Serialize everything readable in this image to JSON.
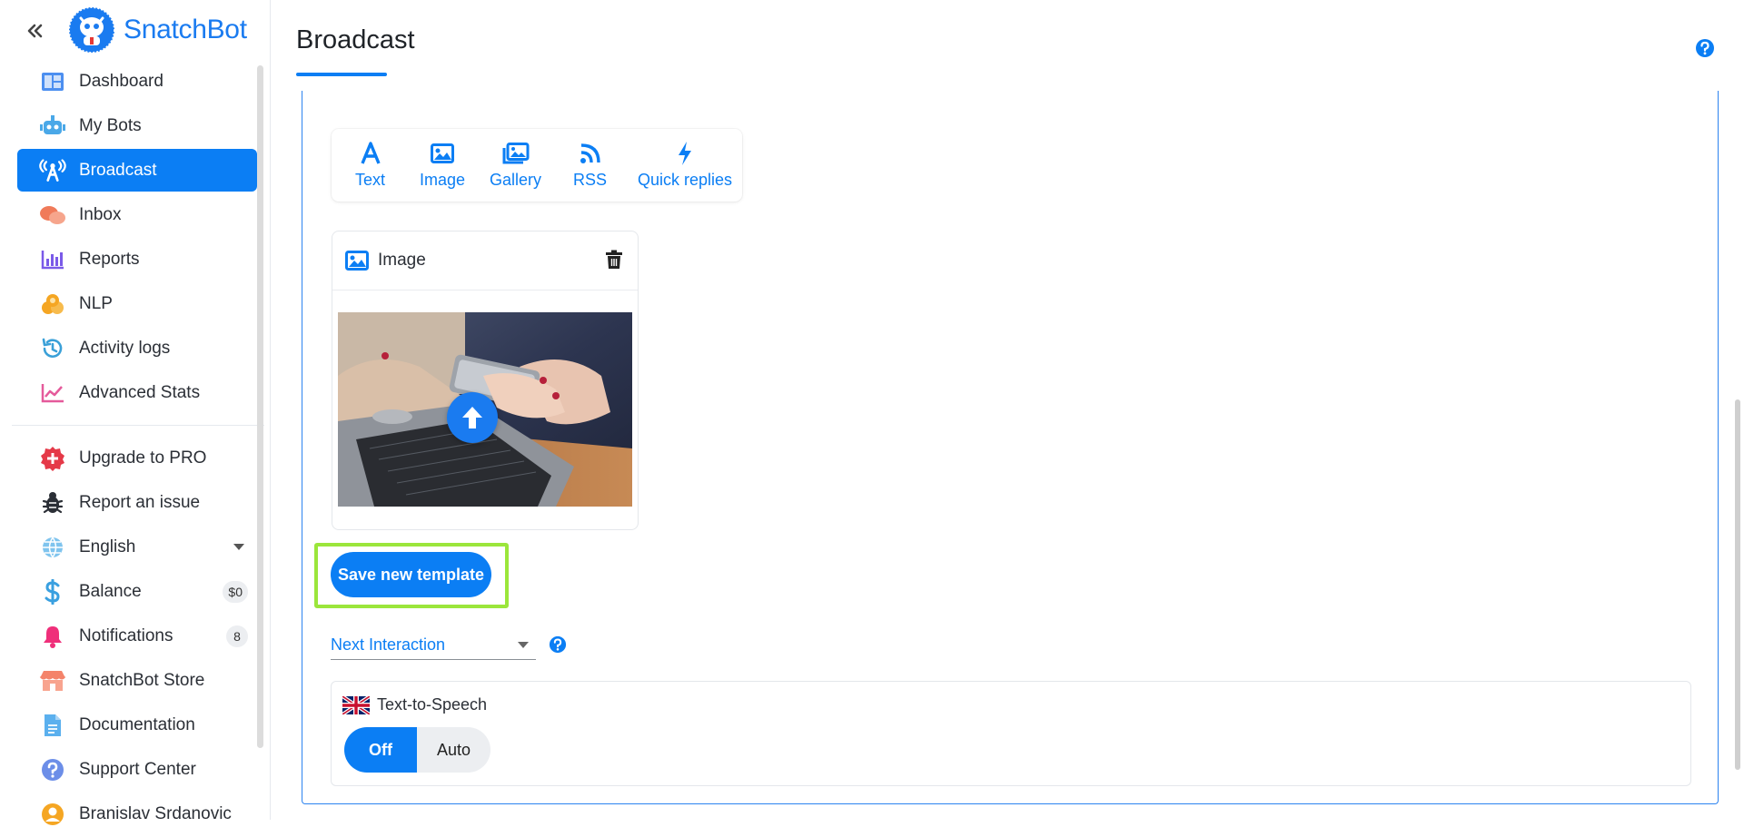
{
  "brand": {
    "name": "SnatchBot",
    "color": "#1a7bf0"
  },
  "sidebar": {
    "collapse_icon": "double-chevron-left-icon",
    "items": [
      {
        "label": "Dashboard",
        "icon": "dashboard-icon"
      },
      {
        "label": "My Bots",
        "icon": "bot-icon"
      },
      {
        "label": "Broadcast",
        "icon": "broadcast-icon",
        "active": true
      },
      {
        "label": "Inbox",
        "icon": "chat-bubbles-icon"
      },
      {
        "label": "Reports",
        "icon": "bar-chart-icon"
      },
      {
        "label": "NLP",
        "icon": "coins-icon"
      },
      {
        "label": "Activity logs",
        "icon": "history-icon"
      },
      {
        "label": "Advanced Stats",
        "icon": "line-chart-icon"
      }
    ],
    "secondary": [
      {
        "label": "Upgrade to PRO",
        "icon": "plus-badge-icon"
      },
      {
        "label": "Report an issue",
        "icon": "bug-icon"
      },
      {
        "label": "English",
        "icon": "globe-icon"
      },
      {
        "label": "Balance",
        "icon": "dollar-icon",
        "badge": "$0"
      },
      {
        "label": "Notifications",
        "icon": "bell-icon",
        "badge": "8"
      },
      {
        "label": "SnatchBot Store",
        "icon": "store-icon"
      },
      {
        "label": "Documentation",
        "icon": "document-icon"
      },
      {
        "label": "Support Center",
        "icon": "question-circle-icon"
      },
      {
        "label": "Branislav Srdanovic",
        "icon": "user-avatar-icon"
      }
    ]
  },
  "page": {
    "title": "Broadcast",
    "accent": "#0b7ef4"
  },
  "toolbar": {
    "tools": [
      {
        "label": "Text",
        "icon": "text-a-icon"
      },
      {
        "label": "Image",
        "icon": "image-icon"
      },
      {
        "label": "Gallery",
        "icon": "gallery-icon"
      },
      {
        "label": "RSS",
        "icon": "rss-icon"
      },
      {
        "label": "Quick replies",
        "icon": "lightning-icon"
      }
    ]
  },
  "image_card": {
    "title": "Image",
    "icon": "image-icon",
    "delete_icon": "trash-icon",
    "upload_icon": "upload-arrow-icon"
  },
  "actions": {
    "save_template": "Save new template",
    "highlight_color": "#9be63b"
  },
  "next_interaction": {
    "selected": "Next Interaction"
  },
  "tts": {
    "label": "Text-to-Speech",
    "flag_icon": "uk-flag-icon",
    "options": [
      "Off",
      "Auto"
    ],
    "selected": "Off"
  }
}
